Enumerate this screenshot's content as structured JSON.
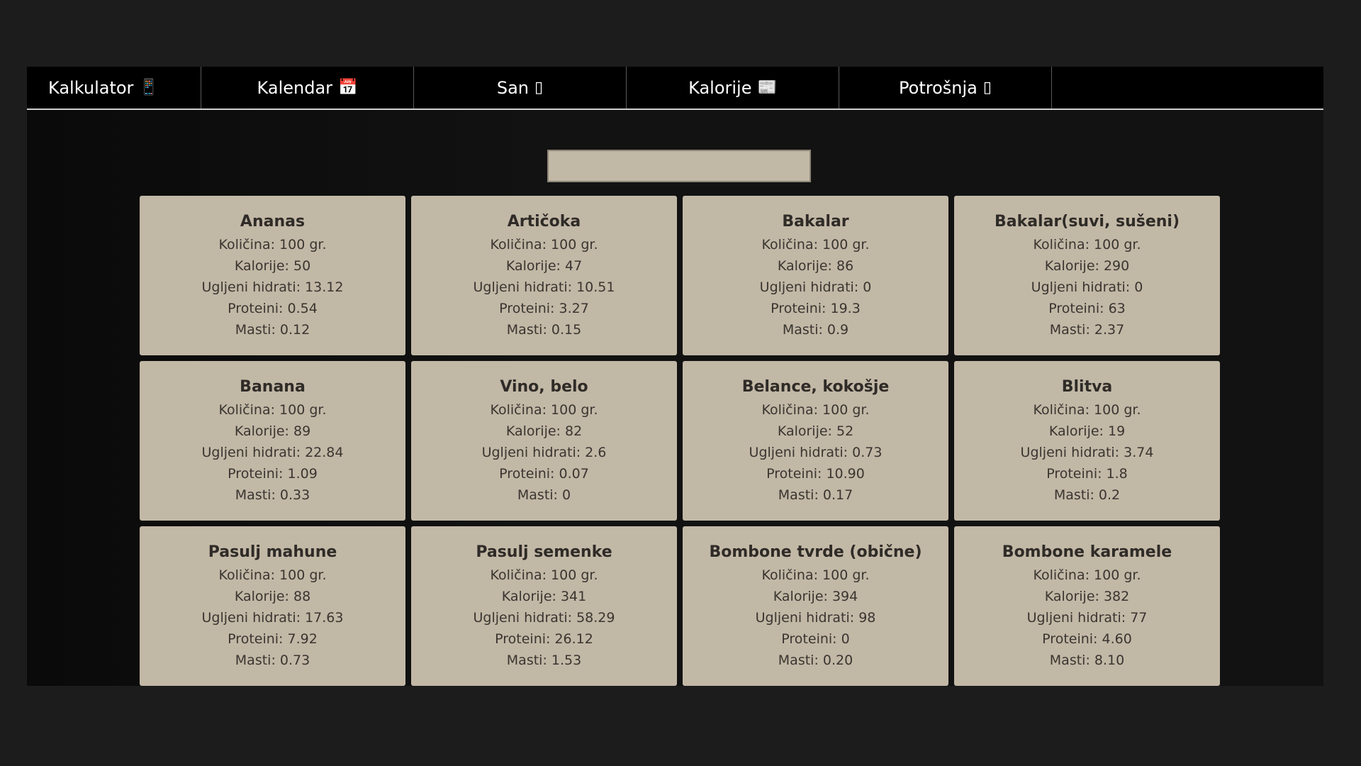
{
  "nav": {
    "items": [
      {
        "label": "Kalkulator",
        "icon": "📱"
      },
      {
        "label": "Kalendar",
        "icon": "📅"
      },
      {
        "label": "San",
        "icon": "▯"
      },
      {
        "label": "Kalorije",
        "icon": "📰"
      },
      {
        "label": "Potrošnja",
        "icon": "▯"
      }
    ]
  },
  "search": {
    "value": "",
    "placeholder": ""
  },
  "foods": [
    {
      "name": "Ananas",
      "kolicina": "Količina: 100 gr.",
      "kalorije": "Kalorije: 50",
      "uh": "Ugljeni hidrati: 13.12",
      "proteini": "Proteini: 0.54",
      "masti": "Masti: 0.12"
    },
    {
      "name": "Artičoka",
      "kolicina": "Količina: 100 gr.",
      "kalorije": "Kalorije: 47",
      "uh": "Ugljeni hidrati: 10.51",
      "proteini": "Proteini: 3.27",
      "masti": "Masti: 0.15"
    },
    {
      "name": "Bakalar",
      "kolicina": "Količina: 100 gr.",
      "kalorije": "Kalorije: 86",
      "uh": "Ugljeni hidrati: 0",
      "proteini": "Proteini: 19.3",
      "masti": "Masti: 0.9"
    },
    {
      "name": "Bakalar(suvi, sušeni)",
      "kolicina": "Količina: 100 gr.",
      "kalorije": "Kalorije: 290",
      "uh": "Ugljeni hidrati: 0",
      "proteini": "Proteini: 63",
      "masti": "Masti: 2.37"
    },
    {
      "name": "Banana",
      "kolicina": "Količina: 100 gr.",
      "kalorije": "Kalorije: 89",
      "uh": "Ugljeni hidrati: 22.84",
      "proteini": "Proteini: 1.09",
      "masti": "Masti: 0.33"
    },
    {
      "name": "Vino, belo",
      "kolicina": "Količina: 100 gr.",
      "kalorije": "Kalorije: 82",
      "uh": "Ugljeni hidrati: 2.6",
      "proteini": "Proteini: 0.07",
      "masti": "Masti: 0"
    },
    {
      "name": "Belance, kokošje",
      "kolicina": "Količina: 100 gr.",
      "kalorije": "Kalorije: 52",
      "uh": "Ugljeni hidrati: 0.73",
      "proteini": "Proteini: 10.90",
      "masti": "Masti: 0.17"
    },
    {
      "name": "Blitva",
      "kolicina": "Količina: 100 gr.",
      "kalorije": "Kalorije: 19",
      "uh": "Ugljeni hidrati: 3.74",
      "proteini": "Proteini: 1.8",
      "masti": "Masti: 0.2"
    },
    {
      "name": "Pasulj mahune",
      "kolicina": "Količina: 100 gr.",
      "kalorije": "Kalorije: 88",
      "uh": "Ugljeni hidrati: 17.63",
      "proteini": "Proteini: 7.92",
      "masti": "Masti: 0.73"
    },
    {
      "name": "Pasulj semenke",
      "kolicina": "Količina: 100 gr.",
      "kalorije": "Kalorije: 341",
      "uh": "Ugljeni hidrati: 58.29",
      "proteini": "Proteini: 26.12",
      "masti": "Masti: 1.53"
    },
    {
      "name": "Bombone tvrde (obične)",
      "kolicina": "Količina: 100 gr.",
      "kalorije": "Kalorije: 394",
      "uh": "Ugljeni hidrati: 98",
      "proteini": "Proteini: 0",
      "masti": "Masti: 0.20"
    },
    {
      "name": "Bombone karamele",
      "kolicina": "Količina: 100 gr.",
      "kalorije": "Kalorije: 382",
      "uh": "Ugljeni hidrati: 77",
      "proteini": "Proteini: 4.60",
      "masti": "Masti: 8.10"
    }
  ],
  "colors": {
    "page_bg": "#1c1c1d",
    "nav_bg": "#000000",
    "card_bg": "#c2b8a6",
    "card_text": "#3a3530"
  }
}
